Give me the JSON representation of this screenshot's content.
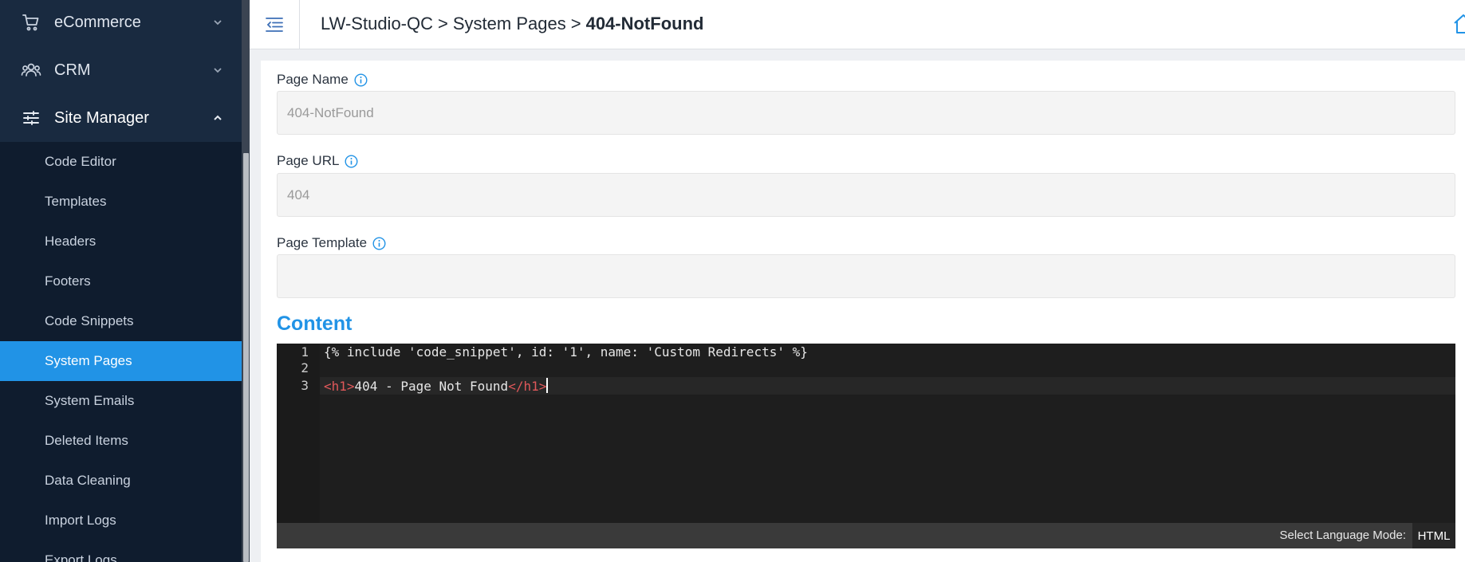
{
  "sidebar": {
    "groups": [
      {
        "label": "eCommerce",
        "icon": "cart-icon",
        "expanded": false
      },
      {
        "label": "CRM",
        "icon": "users-icon",
        "expanded": false
      },
      {
        "label": "Site Manager",
        "icon": "sliders-icon",
        "expanded": true
      }
    ],
    "items": [
      {
        "label": "Code Editor",
        "active": false
      },
      {
        "label": "Templates",
        "active": false
      },
      {
        "label": "Headers",
        "active": false
      },
      {
        "label": "Footers",
        "active": false
      },
      {
        "label": "Code Snippets",
        "active": false
      },
      {
        "label": "System Pages",
        "active": true
      },
      {
        "label": "System Emails",
        "active": false
      },
      {
        "label": "Deleted Items",
        "active": false
      },
      {
        "label": "Data Cleaning",
        "active": false
      },
      {
        "label": "Import Logs",
        "active": false
      },
      {
        "label": "Export Logs",
        "active": false
      }
    ]
  },
  "header": {
    "breadcrumb": [
      "LW-Studio-QC",
      "System Pages",
      "404-NotFound"
    ],
    "separator": ">"
  },
  "form": {
    "page_name": {
      "label": "Page Name",
      "value": "404-NotFound"
    },
    "page_url": {
      "label": "Page URL",
      "value": "404"
    },
    "page_template": {
      "label": "Page Template",
      "value": ""
    },
    "content_title": "Content"
  },
  "editor": {
    "line_numbers": [
      "1",
      "2",
      "3"
    ],
    "line1": "{% include 'code_snippet', id: '1', name: 'Custom Redirects' %}",
    "line3": {
      "open_tag": "<h1>",
      "text": "404 - Page Not Found",
      "close_tag": "</h1>"
    },
    "status_label": "Select Language Mode:",
    "language": "HTML"
  },
  "colors": {
    "sidebar_bg": "#0f1c2e",
    "active_accent": "#2193e6",
    "editor_bg": "#1e1e1e",
    "tag_color": "#e0585a"
  }
}
